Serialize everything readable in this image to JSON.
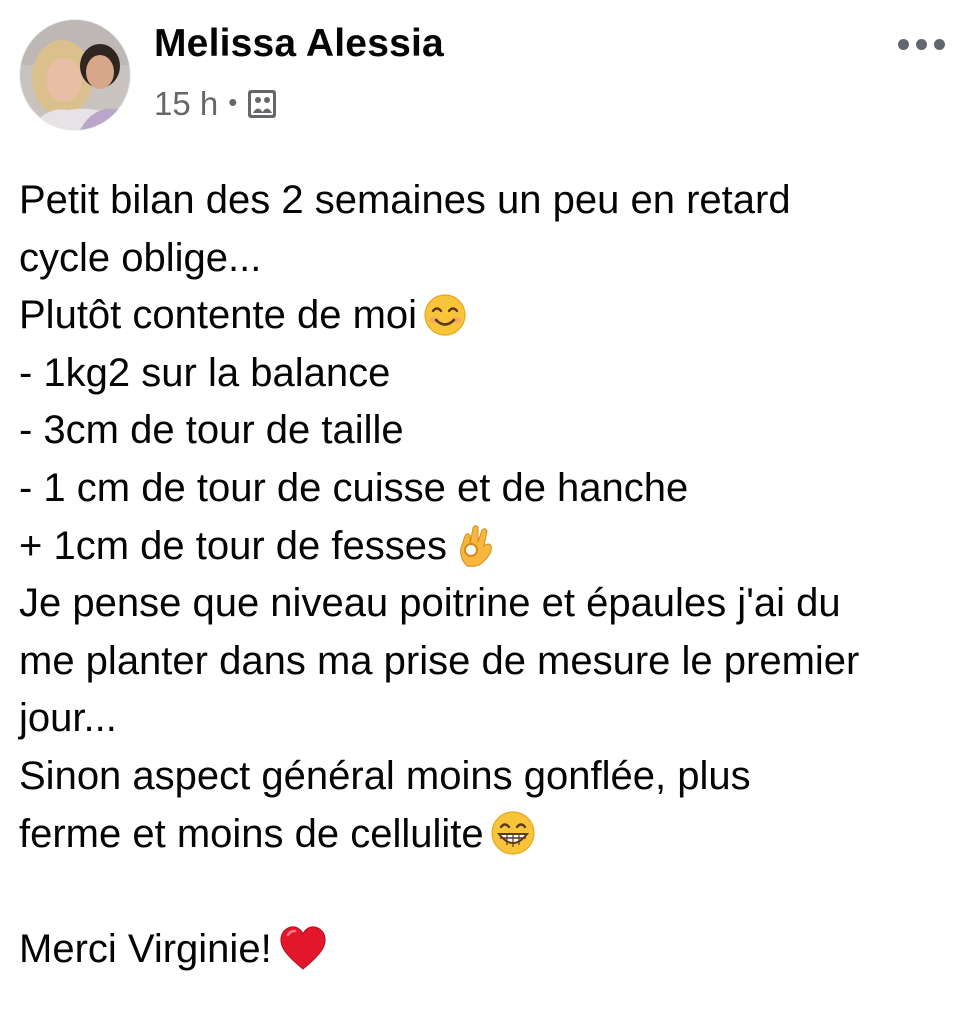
{
  "post": {
    "author": "Melissa Alessia",
    "time": "15 h",
    "separator": "•",
    "audience_icon": "photo-album-icon",
    "more_icon": "more-options-icon",
    "lines": [
      "Petit bilan des 2 semaines un peu en retard",
      "cycle oblige...",
      "Plutôt contente de moi",
      "- 1kg2 sur la balance",
      "- 3cm de tour de taille",
      "- 1 cm de tour de cuisse et de hanche",
      "+ 1cm de tour de fesses",
      "Je pense que niveau poitrine et épaules j'ai du",
      "me planter dans ma prise de mesure le premier",
      "jour...",
      "Sinon aspect général moins gonflée, plus",
      "ferme et moins de cellulite",
      "",
      "Merci Virginie!"
    ],
    "emojis": {
      "smiling_face": "smiling-face-emoji",
      "ok_hand": "ok-hand-emoji",
      "grinning_face": "grinning-face-emoji",
      "red_heart": "red-heart-emoji"
    }
  }
}
